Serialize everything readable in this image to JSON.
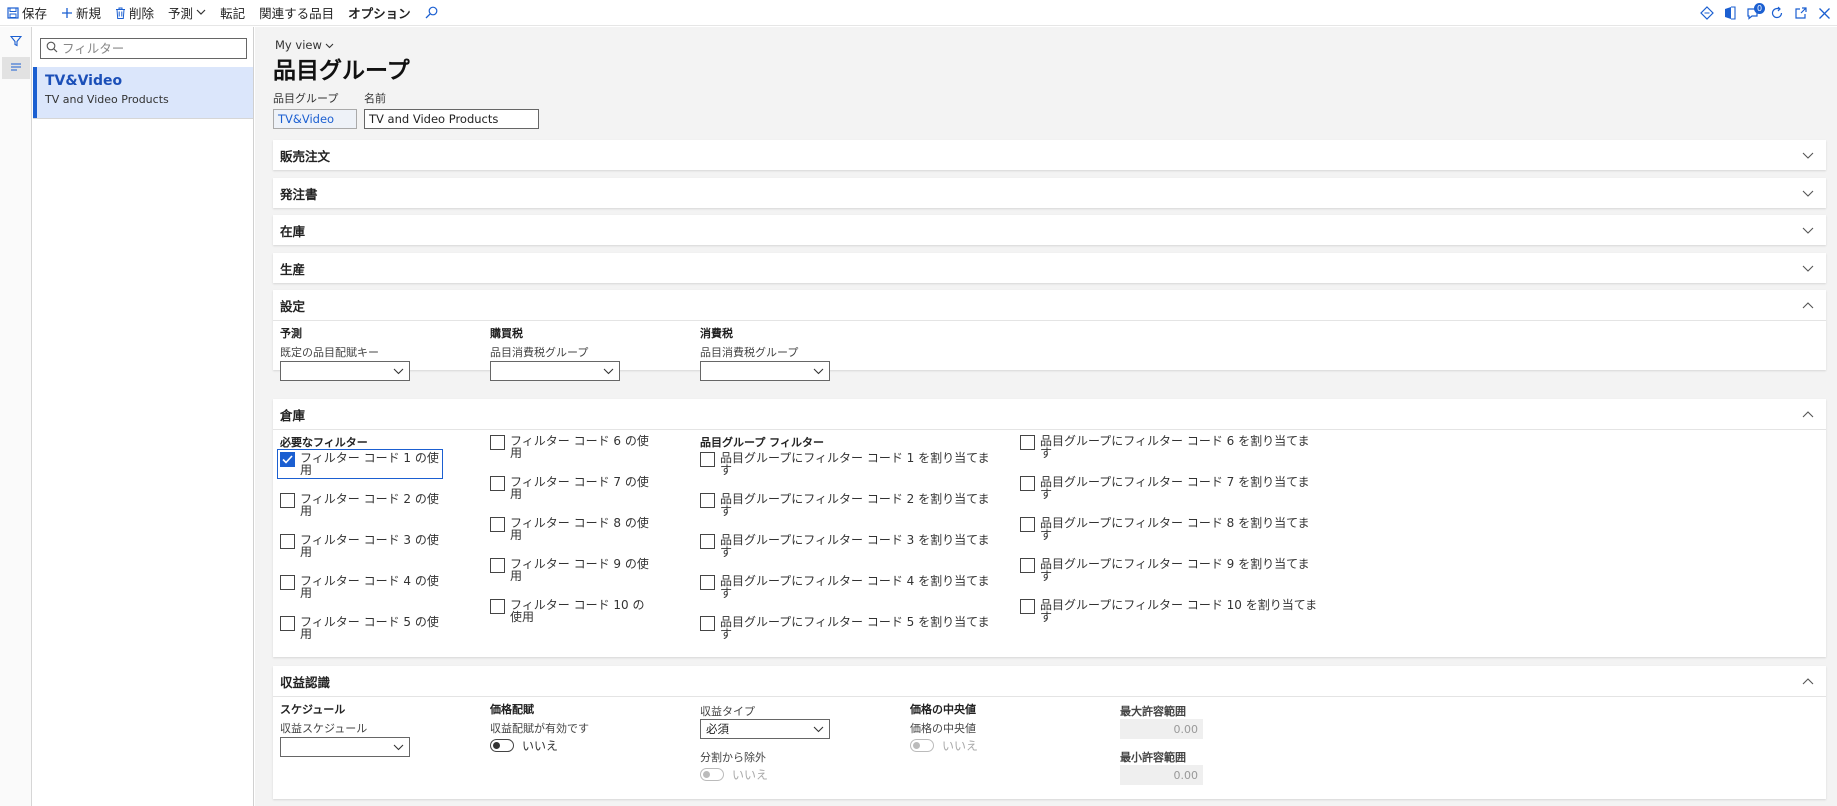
{
  "toolbar": {
    "save": "保存",
    "new": "新規",
    "delete": "削除",
    "forecast": "予測",
    "transfer": "転記",
    "related_items": "関連する品目",
    "options": "オプション",
    "badge_count": "0"
  },
  "filter": {
    "placeholder": "フィルター"
  },
  "list": [
    {
      "title": "TV&Video",
      "subtitle": "TV and Video Products"
    }
  ],
  "header": {
    "my_view": "My view",
    "title": "品目グループ",
    "item_group_label": "品目グループ",
    "item_group_value": "TV&Video",
    "name_label": "名前",
    "name_value": "TV and Video Products"
  },
  "fasttabs": {
    "sales_order": "販売注文",
    "purchase_order": "発注書",
    "inventory": "在庫",
    "production": "生産",
    "setup": "設定",
    "warehouse": "倉庫",
    "revenue_recognition": "収益認識"
  },
  "setup": {
    "forecast_group": "予測",
    "forecast_field": "既定の品目配賦キー",
    "purchase_tax_group": "購買税",
    "purchase_tax_field": "品目消費税グループ",
    "sales_tax_group": "消費税",
    "sales_tax_field": "品目消費税グループ"
  },
  "warehouse": {
    "required_filters": "必要なフィルター",
    "item_group_filters": "品目グループ フィルター",
    "use_codes": [
      {
        "label": "フィルター コード 1 の使用",
        "checked": true
      },
      {
        "label": "フィルター コード 2 の使用",
        "checked": false
      },
      {
        "label": "フィルター コード 3 の使用",
        "checked": false
      },
      {
        "label": "フィルター コード 4 の使用",
        "checked": false
      },
      {
        "label": "フィルター コード 5 の使用",
        "checked": false
      },
      {
        "label": "フィルター コード 6 の使用",
        "checked": false
      },
      {
        "label": "フィルター コード 7 の使用",
        "checked": false
      },
      {
        "label": "フィルター コード 8 の使用",
        "checked": false
      },
      {
        "label": "フィルター コード 9 の使用",
        "checked": false
      },
      {
        "label": "フィルター コード 10 の使用",
        "checked": false
      }
    ],
    "assign_codes": [
      {
        "label": "品目グループにフィルター コード 1 を割り当てます",
        "checked": false
      },
      {
        "label": "品目グループにフィルター コード 2 を割り当てます",
        "checked": false
      },
      {
        "label": "品目グループにフィルター コード 3 を割り当てます",
        "checked": false
      },
      {
        "label": "品目グループにフィルター コード 4 を割り当てます",
        "checked": false
      },
      {
        "label": "品目グループにフィルター コード 5 を割り当てます",
        "checked": false
      },
      {
        "label": "品目グループにフィルター コード 6 を割り当てます",
        "checked": false
      },
      {
        "label": "品目グループにフィルター コード 7 を割り当てます",
        "checked": false
      },
      {
        "label": "品目グループにフィルター コード 8 を割り当てます",
        "checked": false
      },
      {
        "label": "品目グループにフィルター コード 9 を割り当てます",
        "checked": false
      },
      {
        "label": "品目グループにフィルター コード 10 を割り当てます",
        "checked": false
      }
    ]
  },
  "revenue": {
    "schedule_group": "スケジュール",
    "schedule_field": "収益スケジュール",
    "price_alloc_group": "価格配賦",
    "price_alloc_field": "収益配賦が有効です",
    "price_alloc_value": "いいえ",
    "revenue_type_label": "収益タイプ",
    "revenue_type_value": "必須",
    "exclude_split_label": "分割から除外",
    "exclude_split_value": "いいえ",
    "median_group": "価格の中央値",
    "median_field": "価格の中央値",
    "median_value": "いいえ",
    "max_range_label": "最大許容範囲",
    "max_range_value": "0.00",
    "min_range_label": "最小許容範囲",
    "min_range_value": "0.00"
  },
  "colors": {
    "accent": "#1b5fd1",
    "selected_bg": "#dbe6fb"
  }
}
